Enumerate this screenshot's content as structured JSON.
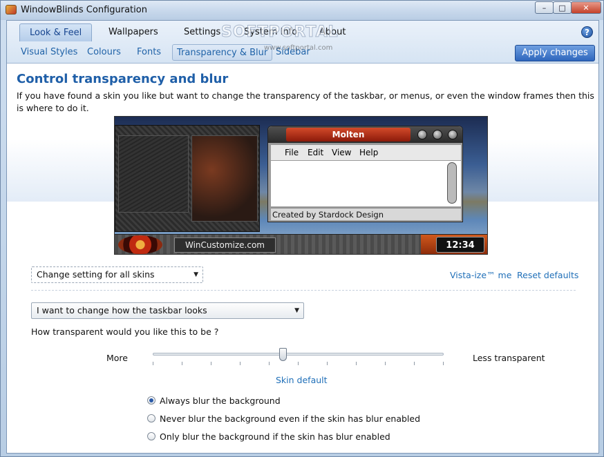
{
  "window": {
    "title": "WindowBlinds Configuration",
    "controls": {
      "minimize": "–",
      "maximize": "□",
      "close": "✕"
    }
  },
  "nav": {
    "tabs": [
      {
        "label": "Look & Feel",
        "active": true
      },
      {
        "label": "Wallpapers",
        "active": false
      },
      {
        "label": "Settings",
        "active": false
      },
      {
        "label": "System Info",
        "active": false
      },
      {
        "label": "About",
        "active": false
      }
    ],
    "subtabs": [
      {
        "label": "Visual Styles",
        "active": false
      },
      {
        "label": "Colours",
        "active": false
      },
      {
        "label": "Fonts",
        "active": false
      },
      {
        "label": "Transparency & Blur",
        "active": true
      },
      {
        "label": "Sidebar",
        "active": false
      }
    ],
    "help_icon": "question-icon",
    "apply_label": "Apply changes"
  },
  "watermark": {
    "large": "SOFTPORTAL",
    "small": "www.softportal.com"
  },
  "content": {
    "heading": "Control transparency and blur",
    "description": "If you have found a skin you like but want to change the transparency of the taskbar, or menus, or even the window frames then this is where to do it."
  },
  "preview": {
    "window_title": "Molten",
    "menu": [
      "File",
      "Edit",
      "View",
      "Help"
    ],
    "status": "Created by Stardock Design",
    "taskbar_button": "WinCustomize.com",
    "clock": "12:34"
  },
  "controls": {
    "skin_scope": "Change setting for all skins",
    "vistaize_link": "Vista-ize™ me",
    "reset_link": "Reset defaults",
    "target_select": "I want to change how the taskbar looks",
    "question": "How transparent would you like this to be ?",
    "slider_left": "More",
    "slider_right": "Less transparent",
    "slider_value": 0.45,
    "slider_default_link": "Skin default",
    "blur_options": [
      {
        "label": "Always blur the background",
        "checked": true
      },
      {
        "label": "Never blur the background even if the skin has blur enabled",
        "checked": false
      },
      {
        "label": "Only blur the background if the skin has blur enabled",
        "checked": false
      }
    ]
  },
  "colors": {
    "accent": "#1f5fa8",
    "link": "#1f6fb8",
    "apply_button": "#2e66bd"
  }
}
